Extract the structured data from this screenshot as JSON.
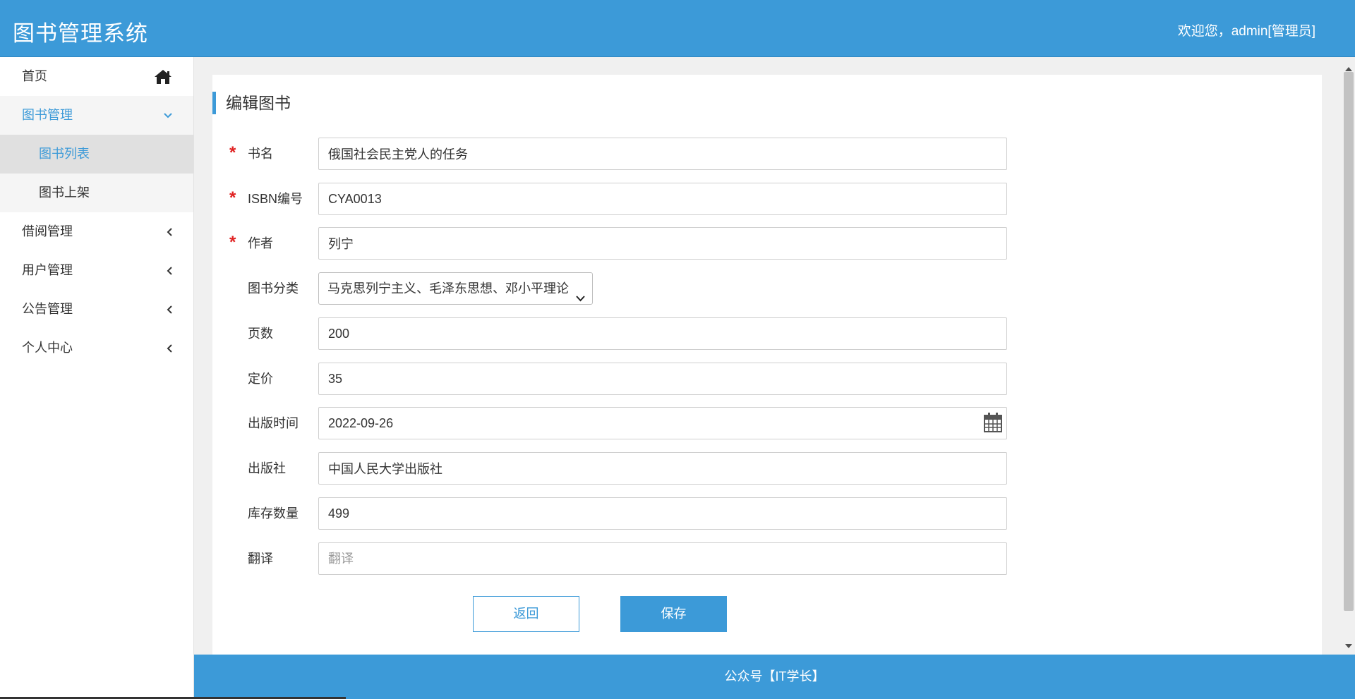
{
  "header": {
    "title": "图书管理系统",
    "welcome": "欢迎您，admin[管理员]"
  },
  "sidebar": {
    "home": "首页",
    "book_mgmt": "图书管理",
    "book_list": "图书列表",
    "book_add": "图书上架",
    "borrow_mgmt": "借阅管理",
    "user_mgmt": "用户管理",
    "notice_mgmt": "公告管理",
    "profile": "个人中心"
  },
  "form": {
    "title": "编辑图书",
    "required_mark": "*",
    "name": {
      "label": "书名",
      "value": "俄国社会民主党人的任务"
    },
    "isbn": {
      "label": "ISBN编号",
      "value": "CYA0013"
    },
    "author": {
      "label": "作者",
      "value": "列宁"
    },
    "category": {
      "label": "图书分类",
      "value": "马克思列宁主义、毛泽东思想、邓小平理论"
    },
    "pages": {
      "label": "页数",
      "value": "200"
    },
    "price": {
      "label": "定价",
      "value": "35"
    },
    "publish_date": {
      "label": "出版时间",
      "value": "2022-09-26"
    },
    "publisher": {
      "label": "出版社",
      "value": "中国人民大学出版社"
    },
    "stock": {
      "label": "库存数量",
      "value": "499"
    },
    "translator": {
      "label": "翻译",
      "value": "",
      "placeholder": "翻译"
    },
    "back_button": "返回",
    "save_button": "保存"
  },
  "footer": {
    "text": "公众号【IT学长】"
  },
  "colors": {
    "primary": "#3c9ad8",
    "required": "#e02020"
  }
}
